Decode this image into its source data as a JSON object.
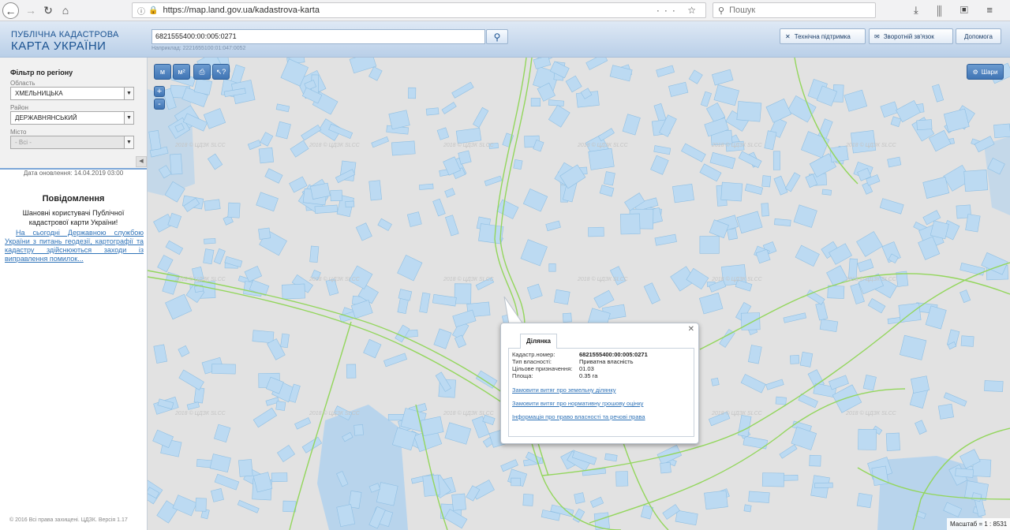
{
  "browser": {
    "url": "https://map.land.gov.ua/kadastrova-karta",
    "search_placeholder": "Пошук"
  },
  "header": {
    "logo_line1": "ПУБЛІЧНА КАДАСТРОВА",
    "logo_line2": "КАРТА УКРАЇНИ",
    "search_value": "6821555400:00:005:0271",
    "search_example": "Наприклад: 2221655100:01:047:0052",
    "support_label": "Технічна підтримка",
    "feedback_label": "Зворотній зв'язок",
    "help_label": "Допомога"
  },
  "sidebar": {
    "filter_title": "Фільтр по регіону",
    "region_label": "Область",
    "region_value": "ХМЕЛЬНИЦЬКА",
    "district_label": "Район",
    "district_value": "ДЕРЖАВНЯНСЬКИЙ",
    "city_label": "Місто",
    "city_value": "- Всі -",
    "update_date": "Дата оновлення: 14.04.2019 03:00",
    "notice_title": "Повідомлення",
    "notice_greeting": "Шановні користувачі Публічної кадастрової карти України!",
    "notice_link": "На сьогодні Державною службою України з питань геодезії, картографії та кадастру здійснюються заходи із виправлення помилок...",
    "copyright": "© 2016 Всі права захищені. ЦДЗК. Версія 1.17"
  },
  "map": {
    "tool_measure_label": "м",
    "tool_area_label": "м²",
    "zoom_in": "+",
    "zoom_out": "-",
    "layers_label": "Шари",
    "watermark": "2018 © ЦДЗК SLCC",
    "scale_text": "Масштаб = 1 : 8531",
    "colors": {
      "map_bg": "#e2e2e2",
      "parcel": "#bcdaf2",
      "parcel_stroke": "#8fbfe3",
      "road": "#93d65c"
    }
  },
  "popup": {
    "tab_label": "Ділянка",
    "cadastral_label": "Кадастр.номер:",
    "cadastral_value": "6821555400:00:005:0271",
    "ownership_label": "Тип власності:",
    "ownership_value": "Приватна власність",
    "purpose_label": "Цільове призначення:",
    "purpose_value": "01.03",
    "area_label": "Площа:",
    "area_value": "0.35 га",
    "link1": "Замовити витяг про земельну ділянку",
    "link2": "Замовити витяг про нормативну грошову оцінку",
    "link3": "Інформація про право власності та речові права"
  }
}
